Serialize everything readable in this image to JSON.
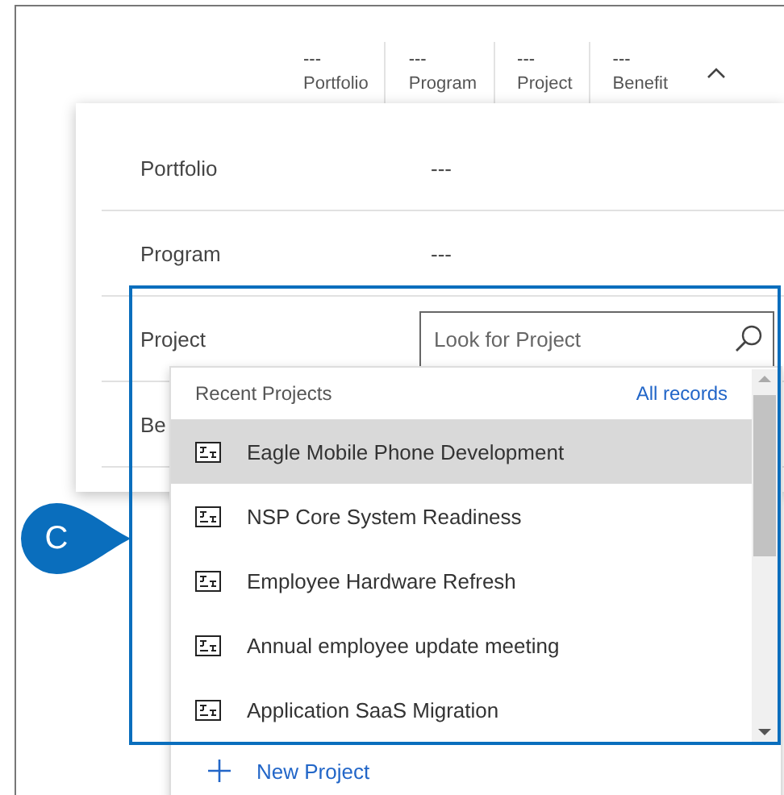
{
  "header_fields": [
    {
      "value": "---",
      "label": "Portfolio"
    },
    {
      "value": "---",
      "label": "Program"
    },
    {
      "value": "---",
      "label": "Project"
    },
    {
      "value": "---",
      "label": "Benefit"
    }
  ],
  "header_expanded": true,
  "flyout": {
    "rows": [
      {
        "kind": "text",
        "label": "Portfolio",
        "value": "---"
      },
      {
        "kind": "text",
        "label": "Program",
        "value": "---"
      },
      {
        "kind": "lookup",
        "label": "Project",
        "placeholder": "Look for Project"
      },
      {
        "kind": "text",
        "label": "Be"
      }
    ]
  },
  "dropdown": {
    "title": "Recent Projects",
    "link": "All records",
    "items": [
      {
        "label": "Eagle Mobile Phone Development",
        "selected": true
      },
      {
        "label": "NSP Core System Readiness",
        "selected": false
      },
      {
        "label": "Employee Hardware Refresh",
        "selected": false
      },
      {
        "label": "Annual employee update meeting",
        "selected": false
      },
      {
        "label": "Application SaaS Migration",
        "selected": false
      }
    ],
    "new_button": "New Project"
  },
  "callout": {
    "label": "C"
  }
}
